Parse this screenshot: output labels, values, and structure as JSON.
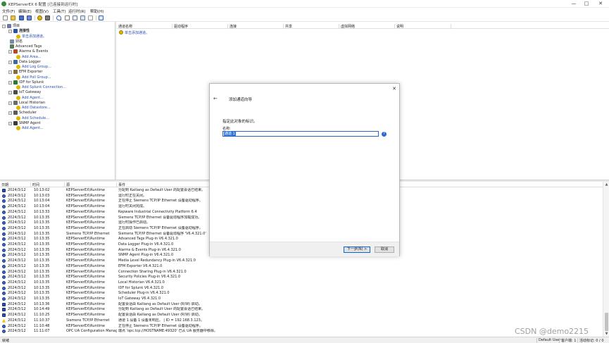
{
  "window": {
    "title": "KEPServerEX 6 配置 [已连接到运行时]",
    "buttons": {
      "minimize": "—",
      "maximize": "□",
      "close": "✕"
    }
  },
  "menubar": [
    "文件(F)",
    "编辑(E)",
    "视图(V)",
    "工具(T)",
    "运行时(R)",
    "帮助(H)"
  ],
  "toolbar_icons": [
    "new-project-icon",
    "open-icon",
    "save-icon",
    "save-as-icon",
    "new-channel-icon",
    "new-device-icon",
    "undo-icon",
    "cut-icon",
    "copy-icon",
    "paste-icon",
    "delete-icon",
    "quick-client-icon"
  ],
  "tree": [
    {
      "label": "项目",
      "level": 0,
      "expander": "−",
      "icon": "project-icon",
      "link": false
    },
    {
      "label": "连接性",
      "level": 1,
      "expander": "−",
      "icon": "connectivity-icon",
      "link": false,
      "bold": true
    },
    {
      "label": "单击添加通道。",
      "level": 2,
      "expander": "",
      "icon": "add-channel-icon",
      "link": true
    },
    {
      "label": "别名",
      "level": 1,
      "expander": "",
      "icon": "aliases-icon",
      "link": false
    },
    {
      "label": "Advanced Tags",
      "level": 1,
      "expander": "",
      "icon": "advanced-tags-icon",
      "link": false
    },
    {
      "label": "Alarms & Events",
      "level": 1,
      "expander": "−",
      "icon": "alarms-icon",
      "link": false
    },
    {
      "label": "Add Area...",
      "level": 2,
      "expander": "",
      "icon": "add-area-icon",
      "link": true
    },
    {
      "label": "Data Logger",
      "level": 1,
      "expander": "−",
      "icon": "data-logger-icon",
      "link": false
    },
    {
      "label": "Add Log Group...",
      "level": 2,
      "expander": "",
      "icon": "add-log-group-icon",
      "link": true
    },
    {
      "label": "EFM Exporter",
      "level": 1,
      "expander": "−",
      "icon": "efm-exporter-icon",
      "link": false
    },
    {
      "label": "Add Poll Group...",
      "level": 2,
      "expander": "",
      "icon": "add-poll-group-icon",
      "link": true
    },
    {
      "label": "IDF for Splunk",
      "level": 1,
      "expander": "−",
      "icon": "splunk-icon",
      "link": false
    },
    {
      "label": "Add Splunk Connection...",
      "level": 2,
      "expander": "",
      "icon": "add-splunk-icon",
      "link": true
    },
    {
      "label": "IoT Gateway",
      "level": 1,
      "expander": "−",
      "icon": "iot-gateway-icon",
      "link": false
    },
    {
      "label": "Add Agent...",
      "level": 2,
      "expander": "",
      "icon": "add-agent-icon",
      "link": true
    },
    {
      "label": "Local Historian",
      "level": 1,
      "expander": "−",
      "icon": "historian-icon",
      "link": false
    },
    {
      "label": "Add Datastore...",
      "level": 2,
      "expander": "",
      "icon": "add-datastore-icon",
      "link": true
    },
    {
      "label": "Scheduler",
      "level": 1,
      "expander": "−",
      "icon": "scheduler-icon",
      "link": false
    },
    {
      "label": "Add Schedule...",
      "level": 2,
      "expander": "",
      "icon": "add-schedule-icon",
      "link": true
    },
    {
      "label": "SNMP Agent",
      "level": 1,
      "expander": "−",
      "icon": "snmp-agent-icon",
      "link": false
    },
    {
      "label": "Add Agent...",
      "level": 2,
      "expander": "",
      "icon": "add-agent-icon",
      "link": true
    }
  ],
  "list": {
    "columns": [
      "通道名称",
      "驱动程序",
      "连接",
      "共享",
      "虚拟网络",
      "说明"
    ],
    "rows": [
      "单击添加通道。"
    ]
  },
  "log": {
    "columns": [
      "日期",
      "时间",
      "源",
      "事件"
    ],
    "rows": [
      {
        "type": "security",
        "date": "2024/3/12",
        "time": "10:13:02",
        "source": "KEPServerEX\\Runtime",
        "event": "分配到 Kailiang as Default User 的配置会话已结束。"
      },
      {
        "type": "info",
        "date": "2024/3/12",
        "time": "10:13:03",
        "source": "KEPServerEX\\Runtime",
        "event": "运行时正在关闭。"
      },
      {
        "type": "info",
        "date": "2024/3/12",
        "time": "10:13:04",
        "source": "KEPServerEX\\Runtime",
        "event": "正在停止 Siemens TCP/IP Ethernet 设备驱动程序。"
      },
      {
        "type": "info",
        "date": "2024/3/12",
        "time": "10:13:04",
        "source": "KEPServerEX\\Runtime",
        "event": "运行时关闭完成。"
      },
      {
        "type": "info",
        "date": "2024/3/12",
        "time": "10:13:33",
        "source": "KEPServerEX\\Runtime",
        "event": "Kepware Industrial Connectivity Platform 6.4"
      },
      {
        "type": "info",
        "date": "2024/3/12",
        "time": "10:13:35",
        "source": "KEPServerEX\\Runtime",
        "event": "Siemens TCP/IP Ethernet 设备驱动程序加载成功。"
      },
      {
        "type": "info",
        "date": "2024/3/12",
        "time": "10:13:35",
        "source": "KEPServerEX\\Runtime",
        "event": "运行时操作已启动。"
      },
      {
        "type": "info",
        "date": "2024/3/12",
        "time": "10:13:35",
        "source": "KEPServerEX\\Runtime",
        "event": "正在启动 Siemens TCP/IP Ethernet 设备驱动程序。"
      },
      {
        "type": "info",
        "date": "2024/3/12",
        "time": "10:13:35",
        "source": "Siemens TCP/IP Ethernet",
        "event": "Siemens TCP/IP Ethernet 设备驱动程序 'V6.4.321.0'"
      },
      {
        "type": "info",
        "date": "2024/3/12",
        "time": "10:13:35",
        "source": "KEPServerEX\\Runtime",
        "event": "Advanced Tags Plug-in V6.4.321.0"
      },
      {
        "type": "info",
        "date": "2024/3/12",
        "time": "10:13:35",
        "source": "KEPServerEX\\Runtime",
        "event": "Data Logger Plug-in V6.4.321.0"
      },
      {
        "type": "info",
        "date": "2024/3/12",
        "time": "10:13:35",
        "source": "KEPServerEX\\Runtime",
        "event": "Alarms & Events Plug-in V6.4.321.0"
      },
      {
        "type": "info",
        "date": "2024/3/12",
        "time": "10:13:35",
        "source": "KEPServerEX\\Runtime",
        "event": "SNMP Agent Plug-in V6.4.321.0"
      },
      {
        "type": "info",
        "date": "2024/3/12",
        "time": "10:13:35",
        "source": "KEPServerEX\\Runtime",
        "event": "Media Level Redundancy Plug-in V6.4.321.0"
      },
      {
        "type": "info",
        "date": "2024/3/12",
        "time": "10:13:35",
        "source": "KEPServerEX\\Runtime",
        "event": "EFM Exporter V6.4.321.0"
      },
      {
        "type": "info",
        "date": "2024/3/12",
        "time": "10:13:35",
        "source": "KEPServerEX\\Runtime",
        "event": "Connection Sharing Plug-in V6.4.321.0"
      },
      {
        "type": "info",
        "date": "2024/3/12",
        "time": "10:13:35",
        "source": "KEPServerEX\\Runtime",
        "event": "Security Policies Plug-in V6.4.321.0"
      },
      {
        "type": "info",
        "date": "2024/3/12",
        "time": "10:13:35",
        "source": "KEPServerEX\\Runtime",
        "event": "Local Historian V6.4.321.0"
      },
      {
        "type": "info",
        "date": "2024/3/12",
        "time": "10:13:35",
        "source": "KEPServerEX\\Runtime",
        "event": "IDF for Splunk V6.4.321.0"
      },
      {
        "type": "info",
        "date": "2024/3/12",
        "time": "10:13:35",
        "source": "KEPServerEX\\Runtime",
        "event": "Scheduler Plug-in V6.4.321.0"
      },
      {
        "type": "info",
        "date": "2024/3/12",
        "time": "10:13:35",
        "source": "KEPServerEX\\Runtime",
        "event": "IoT Gateway V6.4.321.0"
      },
      {
        "type": "security",
        "date": "2024/3/12",
        "time": "10:13:36",
        "source": "KEPServerEX\\Runtime",
        "event": "配置会话由 Kailiang as Default User (R/W) 启动。"
      },
      {
        "type": "security",
        "date": "2024/3/12",
        "time": "10:14:49",
        "source": "KEPServerEX\\Runtime",
        "event": "分配到 Kailiang as Default User 的配置会话已结束。"
      },
      {
        "type": "security",
        "date": "2024/3/12",
        "time": "11:10:25",
        "source": "KEPServerEX\\Runtime",
        "event": "配置会话由 Kailiang as Default User (R/W) 启动。"
      },
      {
        "type": "warning",
        "date": "2024/3/12",
        "time": "11:10:37",
        "source": "Siemens TCP/IP Ethernet",
        "event": "通道 1.设备 1 设备未响应。 | ID = 192.168.3.123。"
      },
      {
        "type": "info",
        "date": "2024/3/12",
        "time": "11:10:48",
        "source": "KEPServerEX\\Runtime",
        "event": "正在停止 Siemens TCP/IP Ethernet 设备驱动程序。"
      },
      {
        "type": "info",
        "date": "2024/3/12",
        "time": "11:11:07",
        "source": "OPC UA Configuration Manager",
        "event": "端点 'opc.tcp://HOSTNAME:49320' 已从 UA 服务器中移除。"
      }
    ]
  },
  "dialog": {
    "title": "添加通道向导",
    "back": "←",
    "close": "✕",
    "description": "指定此对象的标识。",
    "name_label": "名称:",
    "name_value": "通道 1",
    "help": "?",
    "next_button": "下一步(N) >",
    "cancel_button": "取消"
  },
  "status": {
    "left": "就绪",
    "user": "Default User",
    "clients": "客户端: 1",
    "active_tags": "活动标记: 0 / 0"
  },
  "watermark": "CSDN @demo2215"
}
